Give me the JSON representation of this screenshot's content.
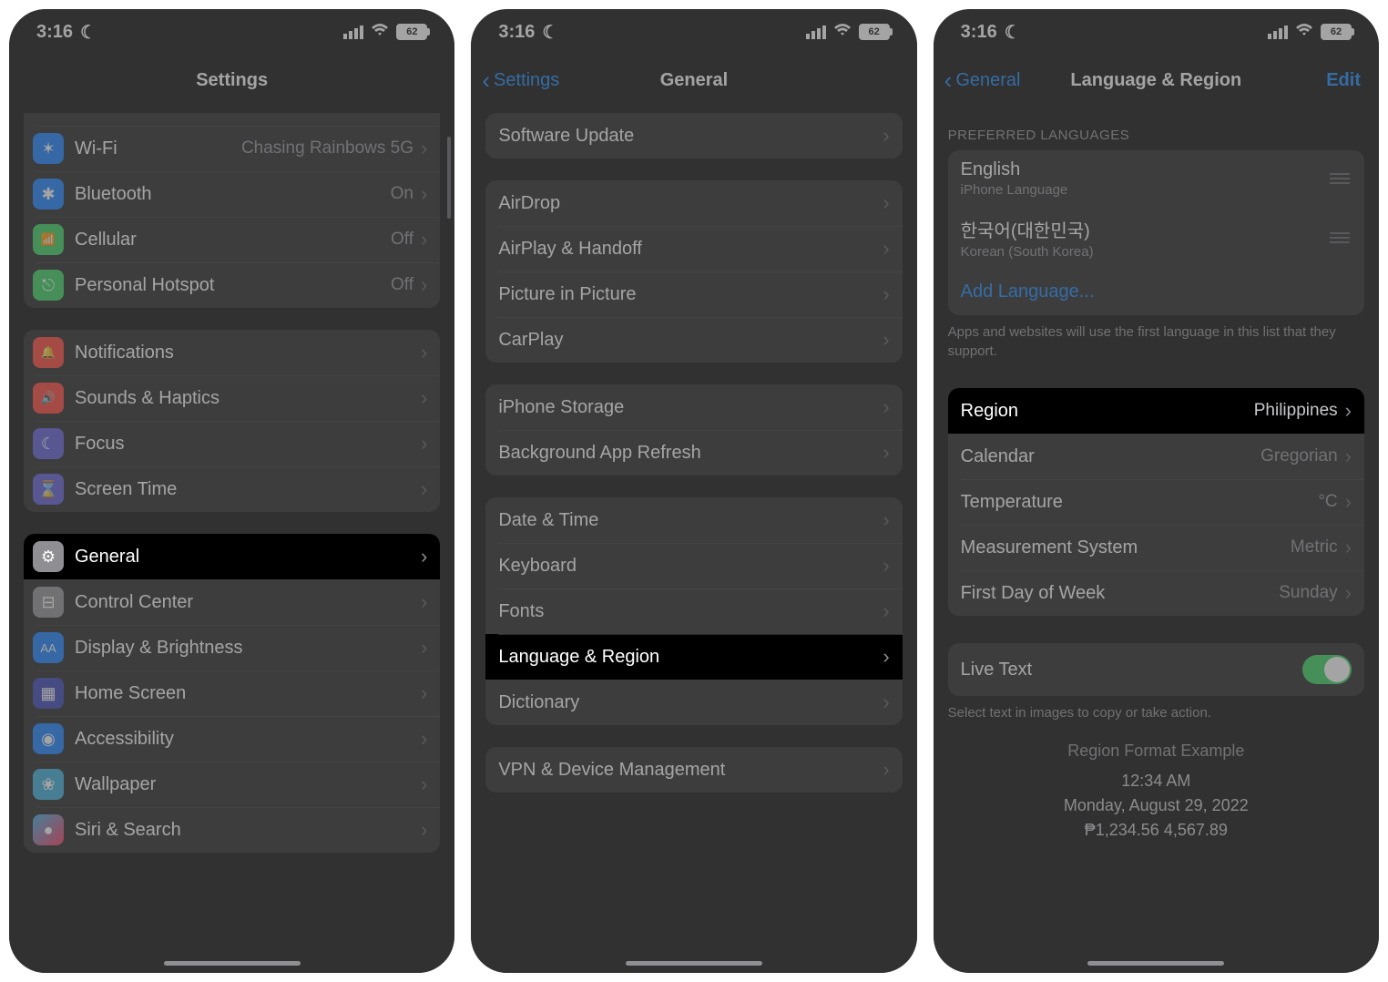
{
  "status": {
    "time": "3:16",
    "battery": "62"
  },
  "phone1": {
    "title": "Settings",
    "groups": [
      [
        {
          "icon": "app-icon",
          "label": "",
          "value": "",
          "cls": "ic-app",
          "partial": true
        },
        {
          "icon": "wifi-icon",
          "label": "Wi-Fi",
          "value": "Chasing Rainbows 5G",
          "cls": "ic-wifi",
          "glyph": "✶"
        },
        {
          "icon": "bluetooth-icon",
          "label": "Bluetooth",
          "value": "On",
          "cls": "ic-bt",
          "glyph": "✱"
        },
        {
          "icon": "cellular-icon",
          "label": "Cellular",
          "value": "Off",
          "cls": "ic-cell",
          "glyph": "📶"
        },
        {
          "icon": "hotspot-icon",
          "label": "Personal Hotspot",
          "value": "Off",
          "cls": "ic-hot",
          "glyph": "⎋"
        }
      ],
      [
        {
          "icon": "notifications-icon",
          "label": "Notifications",
          "cls": "ic-notif",
          "glyph": "🔔"
        },
        {
          "icon": "sounds-icon",
          "label": "Sounds & Haptics",
          "cls": "ic-sound",
          "glyph": "🔊"
        },
        {
          "icon": "focus-icon",
          "label": "Focus",
          "cls": "ic-focus",
          "glyph": "☾"
        },
        {
          "icon": "screentime-icon",
          "label": "Screen Time",
          "cls": "ic-screen",
          "glyph": "⌛"
        }
      ],
      [
        {
          "icon": "gear-icon",
          "label": "General",
          "cls": "ic-gear",
          "glyph": "⚙",
          "highlight": true
        },
        {
          "icon": "control-center-icon",
          "label": "Control Center",
          "cls": "ic-cc",
          "glyph": "⊟"
        },
        {
          "icon": "display-icon",
          "label": "Display & Brightness",
          "cls": "ic-disp",
          "glyph": "AA"
        },
        {
          "icon": "home-screen-icon",
          "label": "Home Screen",
          "cls": "ic-home",
          "glyph": "▦"
        },
        {
          "icon": "accessibility-icon",
          "label": "Accessibility",
          "cls": "ic-acc",
          "glyph": "◉"
        },
        {
          "icon": "wallpaper-icon",
          "label": "Wallpaper",
          "cls": "ic-wall",
          "glyph": "❀"
        },
        {
          "icon": "siri-icon",
          "label": "Siri & Search",
          "cls": "ic-siri",
          "glyph": "●"
        }
      ]
    ]
  },
  "phone2": {
    "back": "Settings",
    "title": "General",
    "groups": [
      [
        {
          "label": "Software Update"
        }
      ],
      [
        {
          "label": "AirDrop"
        },
        {
          "label": "AirPlay & Handoff"
        },
        {
          "label": "Picture in Picture"
        },
        {
          "label": "CarPlay"
        }
      ],
      [
        {
          "label": "iPhone Storage"
        },
        {
          "label": "Background App Refresh"
        }
      ],
      [
        {
          "label": "Date & Time"
        },
        {
          "label": "Keyboard"
        },
        {
          "label": "Fonts"
        },
        {
          "label": "Language & Region",
          "highlight": true
        },
        {
          "label": "Dictionary"
        }
      ],
      [
        {
          "label": "VPN & Device Management"
        }
      ]
    ]
  },
  "phone3": {
    "back": "General",
    "title": "Language & Region",
    "edit": "Edit",
    "pref_header": "PREFERRED LANGUAGES",
    "languages": [
      {
        "title": "English",
        "sub": "iPhone Language"
      },
      {
        "title": "한국어(대한민국)",
        "sub": "Korean (South Korea)"
      }
    ],
    "add": "Add Language...",
    "pref_footer": "Apps and websites will use the first language in this list that they support.",
    "rows": [
      {
        "label": "Region",
        "value": "Philippines",
        "highlight": true
      },
      {
        "label": "Calendar",
        "value": "Gregorian"
      },
      {
        "label": "Temperature",
        "value": "°C"
      },
      {
        "label": "Measurement System",
        "value": "Metric"
      },
      {
        "label": "First Day of Week",
        "value": "Sunday"
      }
    ],
    "livetext": {
      "label": "Live Text",
      "footer": "Select text in images to copy or take action."
    },
    "example": {
      "header": "Region Format Example",
      "time": "12:34 AM",
      "date": "Monday, August 29, 2022",
      "nums": "₱1,234.56   4,567.89"
    }
  }
}
